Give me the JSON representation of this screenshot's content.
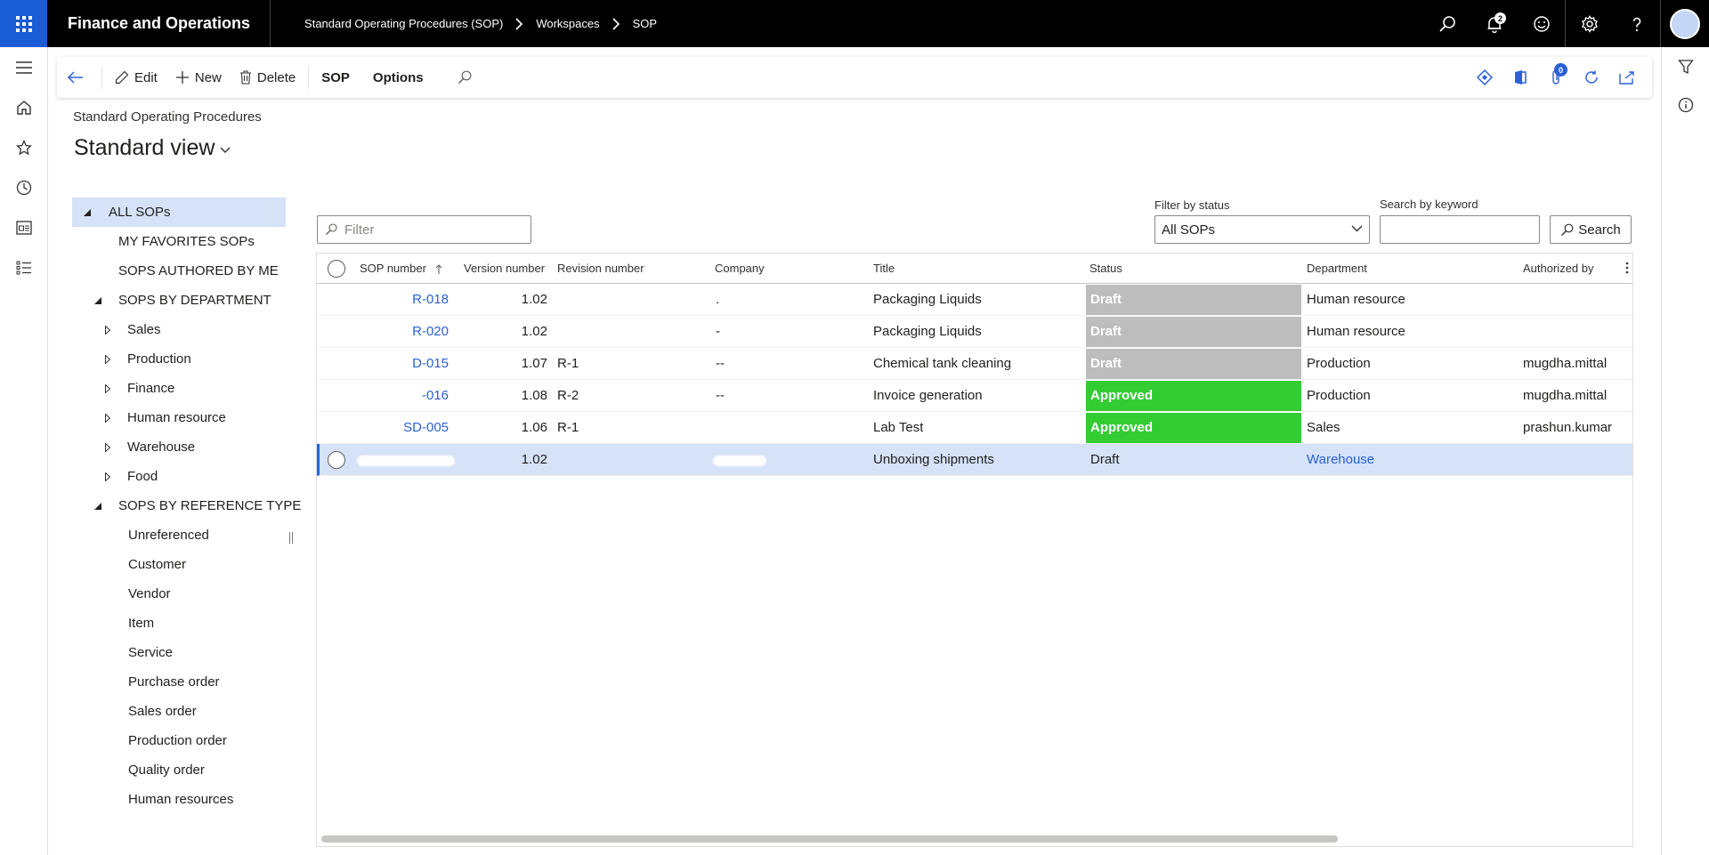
{
  "topbar": {
    "app_title": "Finance and Operations",
    "breadcrumbs": [
      "Standard Operating Procedures (SOP)",
      "Workspaces",
      "SOP"
    ],
    "notification_count": "2"
  },
  "actionpane": {
    "edit": "Edit",
    "new": "New",
    "delete": "Delete",
    "sop": "SOP",
    "options": "Options",
    "attachment_count": "0"
  },
  "page": {
    "caption": "Standard Operating Procedures",
    "view_title": "Standard view"
  },
  "tree": {
    "all": "ALL SOPs",
    "favorites": "MY FAVORITES SOPs",
    "authored": "SOPS AUTHORED BY ME",
    "by_department": "SOPS BY DEPARTMENT",
    "departments": [
      "Sales",
      "Production",
      "Finance",
      "Human resource",
      "Warehouse",
      "Food"
    ],
    "by_reference": "SOPS BY REFERENCE TYPE",
    "references": [
      "Unreferenced",
      "Customer",
      "Vendor",
      "Item",
      "Service",
      "Purchase order",
      "Sales order",
      "Production order",
      "Quality order",
      "Human resources"
    ]
  },
  "filters": {
    "filter_placeholder": "Filter",
    "status_label": "Filter by status",
    "status_value": "All SOPs",
    "keyword_label": "Search by keyword",
    "keyword_value": "",
    "search_button": "Search"
  },
  "grid": {
    "columns": [
      "SOP number",
      "Version number",
      "Revision number",
      "Company",
      "Title",
      "Status",
      "Department",
      "Authorized by"
    ],
    "rows": [
      {
        "sop": "R-018",
        "version": "1.02",
        "revision": "",
        "company": ".",
        "title": "Packaging Liquids",
        "status": "Draft",
        "department": "Human resource",
        "authorized": ""
      },
      {
        "sop": "R-020",
        "version": "1.02",
        "revision": "",
        "company": "-",
        "title": "Packaging Liquids",
        "status": "Draft",
        "department": "Human resource",
        "authorized": ""
      },
      {
        "sop": "D-015",
        "version": "1.07",
        "revision": "R-1",
        "company": "--",
        "title": "Chemical tank cleaning",
        "status": "Draft",
        "department": "Production",
        "authorized": "mugdha.mittal"
      },
      {
        "sop": "-016",
        "version": "1.08",
        "revision": "R-2",
        "company": "--",
        "title": "Invoice generation",
        "status": "Approved",
        "department": "Production",
        "authorized": "mugdha.mittal"
      },
      {
        "sop": "SD-005",
        "version": "1.06",
        "revision": "R-1",
        "company": "",
        "title": "Lab Test",
        "status": "Approved",
        "department": "Sales",
        "authorized": "prashun.kumar"
      },
      {
        "sop": "",
        "version": "1.02",
        "revision": "",
        "company": "",
        "title": "Unboxing shipments",
        "status": "Draft",
        "department": "Warehouse",
        "authorized": ""
      }
    ]
  },
  "colors": {
    "draft": "#bdbdbd",
    "approved": "#33cc33",
    "accent": "#2a61d6",
    "waffle": "#1a5bd6"
  }
}
